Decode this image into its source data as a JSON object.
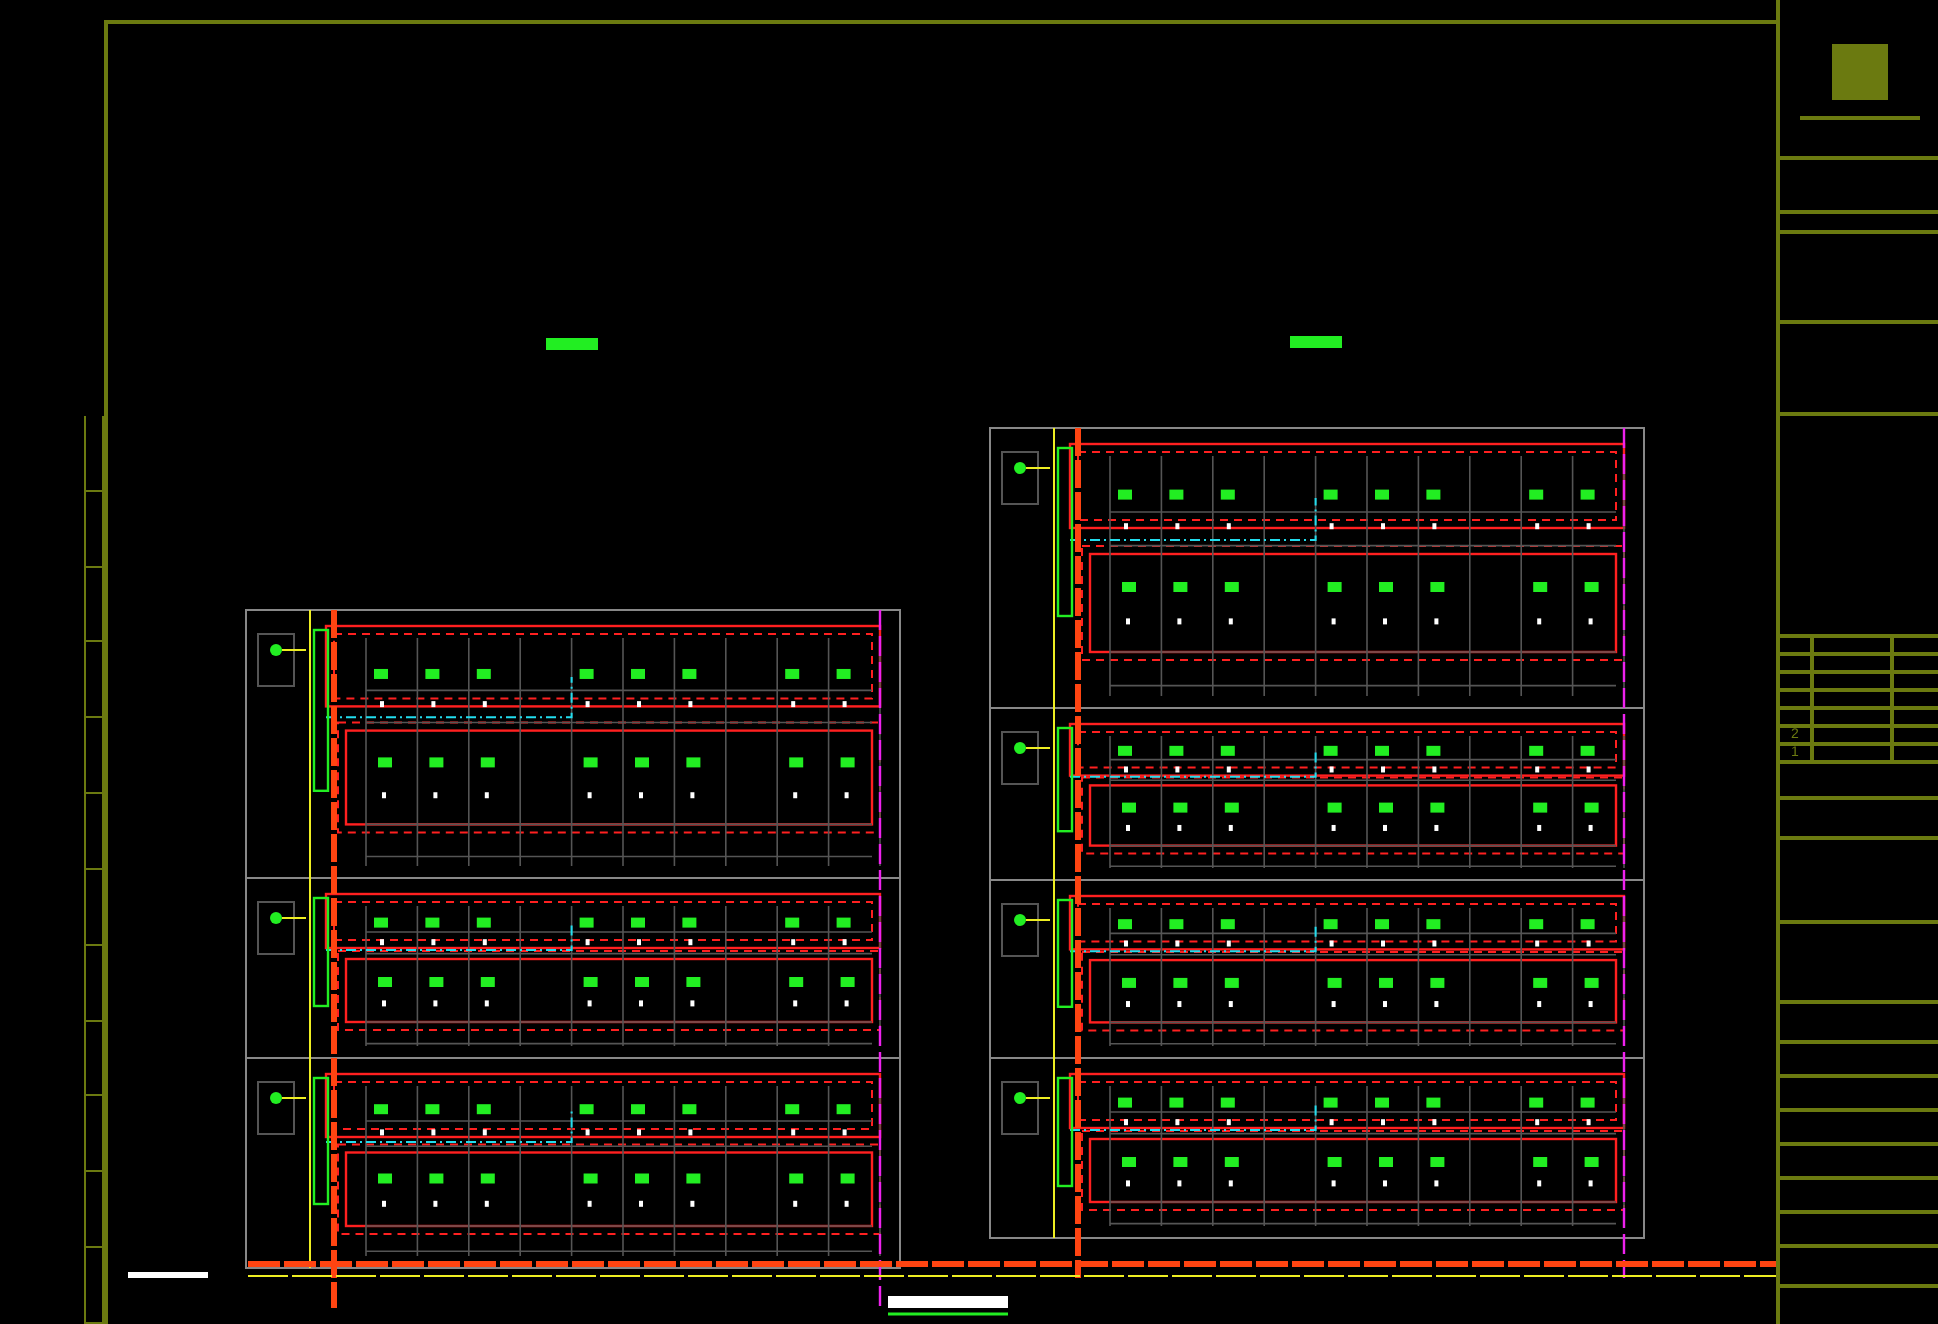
{
  "title_block": {
    "revisions": [
      {
        "number": "2"
      },
      {
        "number": "1"
      }
    ]
  }
}
